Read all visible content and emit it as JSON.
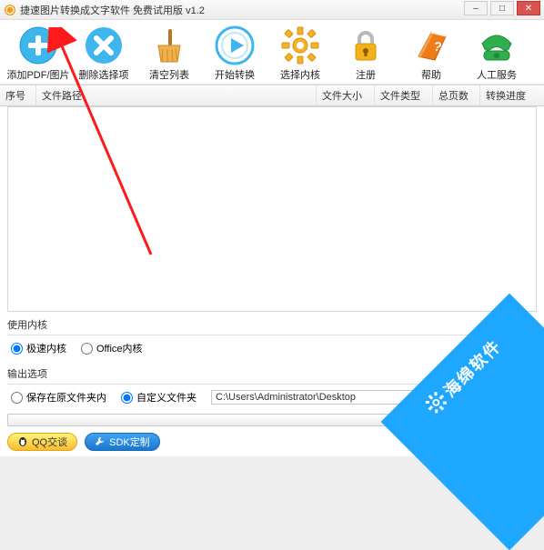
{
  "titlebar": {
    "title": "捷速图片转换成文字软件 免费试用版 v1.2"
  },
  "toolbar": [
    {
      "key": "add",
      "label": "添加PDF/图片"
    },
    {
      "key": "remove",
      "label": "删除选择项"
    },
    {
      "key": "clear",
      "label": "清空列表"
    },
    {
      "key": "start",
      "label": "开始转换"
    },
    {
      "key": "kernel",
      "label": "选择内核"
    },
    {
      "key": "reg",
      "label": "注册"
    },
    {
      "key": "help",
      "label": "帮助"
    },
    {
      "key": "service",
      "label": "人工服务"
    }
  ],
  "columns": {
    "index": "序号",
    "path": "文件路径",
    "size": "文件大小",
    "type": "文件类型",
    "pages": "总页数",
    "progress": "转换进度"
  },
  "kernel_group": {
    "title": "使用内核",
    "opt_fast": "极速内核",
    "opt_office": "Office内核",
    "selected": "fast"
  },
  "output_group": {
    "title": "输出选项",
    "opt_same": "保存在原文件夹内",
    "opt_custom": "自定义文件夹",
    "selected": "custom",
    "path": "C:\\Users\\Administrator\\Desktop"
  },
  "footer": {
    "qq": "QQ交谈",
    "sdk": "SDK定制"
  },
  "ribbon": "海绵软件"
}
